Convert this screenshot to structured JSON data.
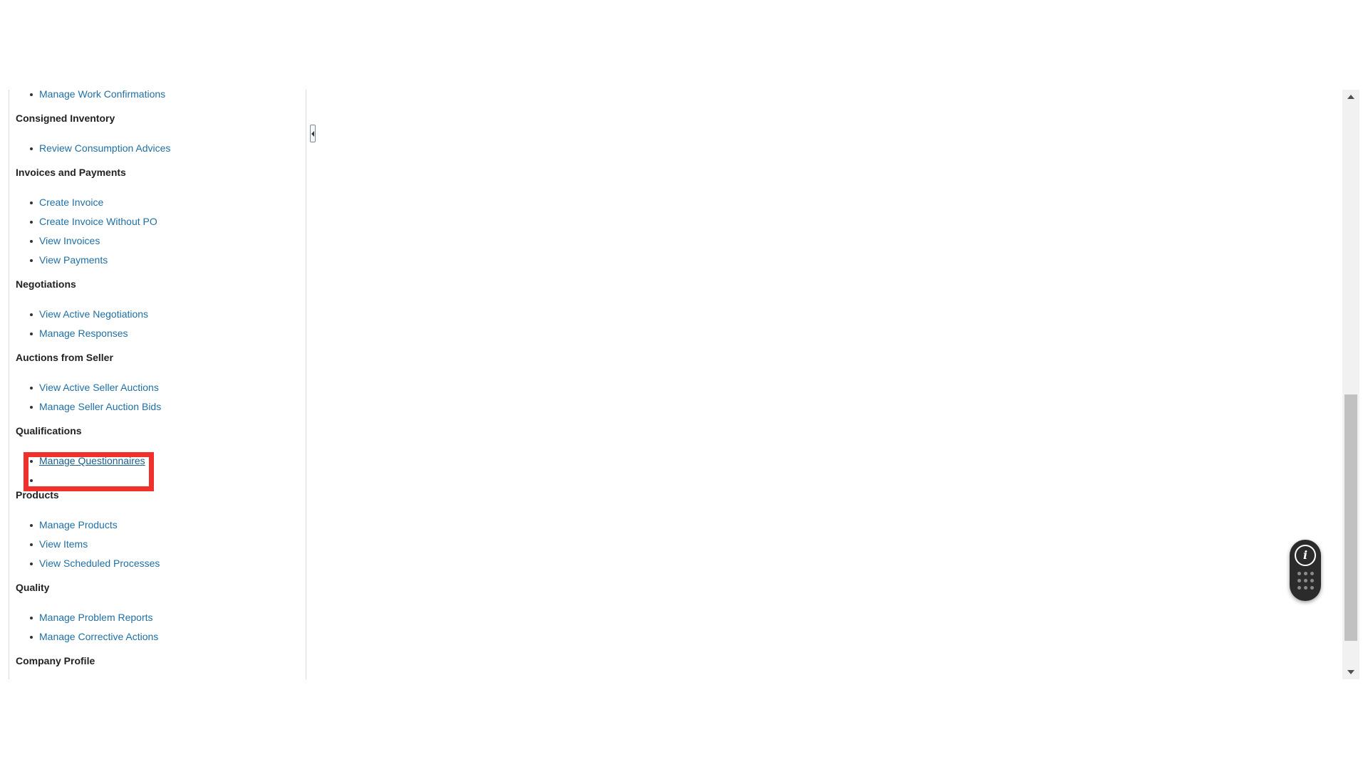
{
  "task_panel": {
    "top_links": [
      "Manage Work Confirmations"
    ],
    "sections": [
      {
        "title": "Consigned Inventory",
        "links": [
          "Review Consumption Advices"
        ]
      },
      {
        "title": "Invoices and Payments",
        "links": [
          "Create Invoice",
          "Create Invoice Without PO",
          "View Invoices",
          "View Payments"
        ]
      },
      {
        "title": "Negotiations",
        "links": [
          "View Active Negotiations",
          "Manage Responses"
        ]
      },
      {
        "title": "Auctions from Seller",
        "links": [
          "View Active Seller Auctions",
          "Manage Seller Auction Bids"
        ]
      },
      {
        "title": "Qualifications",
        "links": [
          "Manage Questionnaires"
        ]
      },
      {
        "title": "Products",
        "links": [
          "Manage Products",
          "View Items",
          "View Scheduled Processes"
        ]
      },
      {
        "title": "Quality",
        "links": [
          "Manage Problem Reports",
          "Manage Corrective Actions"
        ]
      },
      {
        "title": "Company Profile",
        "links": []
      }
    ],
    "highlighted_link": "Manage Questionnaires"
  },
  "help_widget": {
    "info_glyph": "i",
    "icon": "info-icon"
  },
  "colors": {
    "link": "#1f6fa4",
    "highlight": "#f0302a",
    "widget": "#2b2b2b"
  }
}
